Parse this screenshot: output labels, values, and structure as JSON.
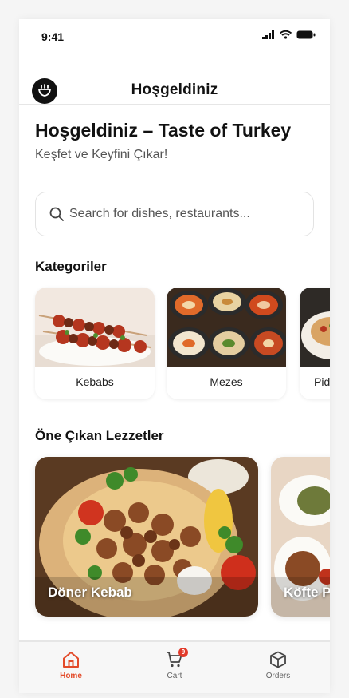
{
  "status_bar": {
    "time": "9:41"
  },
  "app_bar": {
    "title": "Hoşgeldiniz",
    "logo_icon": "chef-pot-icon"
  },
  "hero": {
    "title": "Hoşgeldiniz – Taste of Turkey",
    "subtitle": "Keşfet ve Keyfini Çıkar!"
  },
  "search": {
    "placeholder": "Search for dishes, restaurants..."
  },
  "categories": {
    "title": "Kategoriler",
    "items": [
      {
        "label": "Kebabs"
      },
      {
        "label": "Mezes"
      },
      {
        "label": "Pid"
      }
    ]
  },
  "featured": {
    "title": "Öne Çıkan Lezzetler",
    "items": [
      {
        "label": "Döner Kebab"
      },
      {
        "label": "Köfte P"
      }
    ]
  },
  "tab_bar": {
    "items": [
      {
        "label": "Home",
        "icon": "home-icon",
        "active": true
      },
      {
        "label": "Cart",
        "icon": "cart-icon",
        "badge": "9"
      },
      {
        "label": "Orders",
        "icon": "box-icon"
      }
    ]
  },
  "colors": {
    "accent": "#e34b2a",
    "badge": "#e23a2a"
  }
}
